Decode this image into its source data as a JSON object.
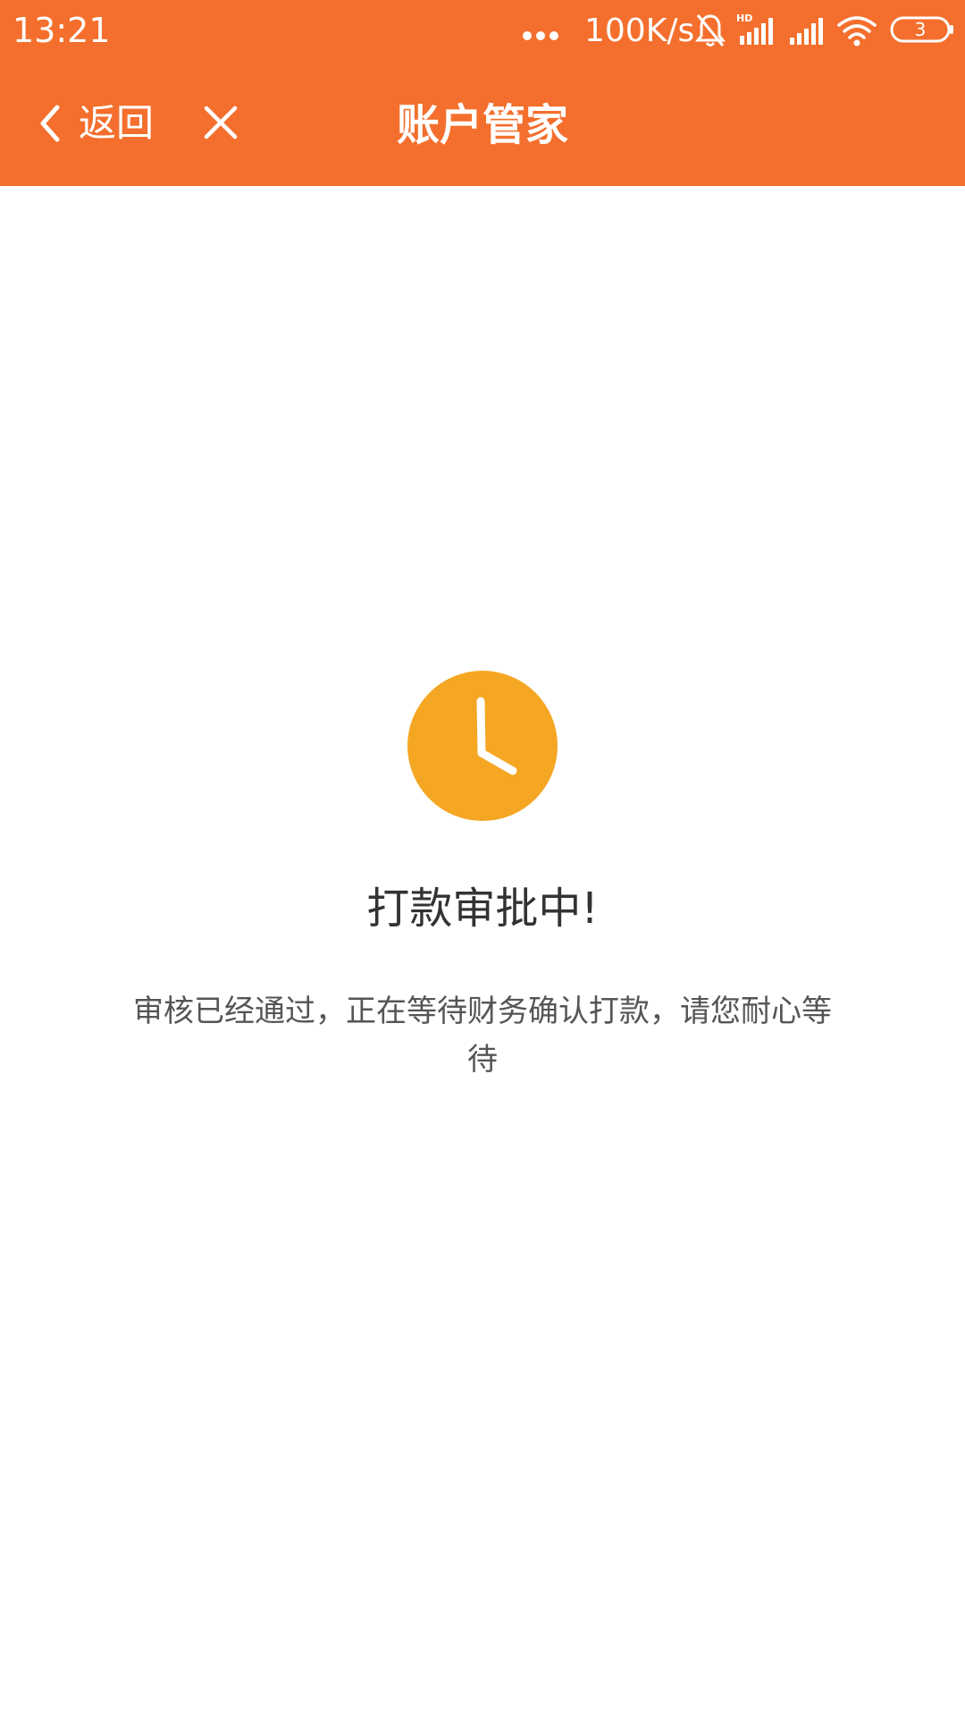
{
  "status_bar": {
    "time": "13:21",
    "network_speed": "100K/s",
    "battery_level": "3",
    "icons": [
      "more-dots-icon",
      "mute-bell-icon",
      "hd-signal-icon",
      "signal-icon",
      "wifi-icon",
      "battery-icon"
    ]
  },
  "nav": {
    "back_label": "返回",
    "title": "账户管家"
  },
  "content": {
    "status_title": "打款审批中!",
    "status_desc": "审核已经通过，正在等待财务确认打款，请您耐心等待"
  },
  "colors": {
    "header_bg": "#f46f2d",
    "clock_bg": "#f5a623",
    "title_text": "#333333",
    "desc_text": "#555555"
  }
}
